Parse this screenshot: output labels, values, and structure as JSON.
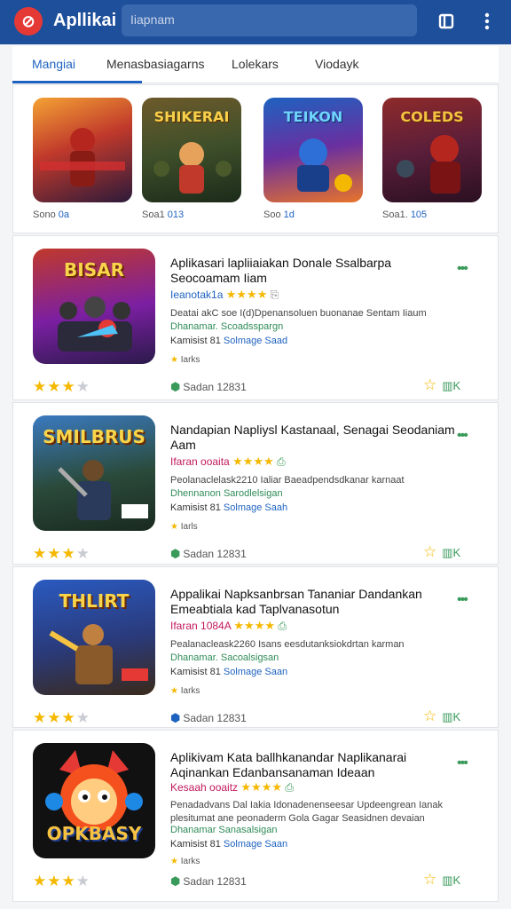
{
  "appbar": {
    "logo_glyph": "⊘",
    "title": "Apllikai",
    "search_placeholder": "Iiapnam",
    "icons": [
      "bookmark-icon",
      "more-vert-icon"
    ]
  },
  "tabs": [
    "Mangiai",
    "Menasbasiagarns",
    "Lolekars",
    "Viodayk"
  ],
  "featured": [
    {
      "name": "",
      "label": "Sono",
      "value": "0a"
    },
    {
      "name": "SHIKERAI",
      "label": "Soa1",
      "value": "013"
    },
    {
      "name": "TEIKON",
      "label": "Soo",
      "value": "1d"
    },
    {
      "name": "COLEDS",
      "label": "Soa1.",
      "value": "105"
    }
  ],
  "apps": [
    {
      "img_title": "BISAR",
      "title": "Aplikasari lapliiaiakan Donale Ssalbarpa Seocoamam Iiam",
      "rating_label": "Ieanotak1a",
      "rating_label_color": "blue",
      "desc": "Deatai akC soe I(d)Dpenansoluen buonanae Sentam Iiaum",
      "dev": "Dhanamar. Scoadsspargn",
      "size_prefix": "Kamisist 81",
      "size_value": "Solmage Saad",
      "tag": "Iarks",
      "date": "Sadan 12831",
      "pin_color": "green"
    },
    {
      "img_title": "SMILBRUS",
      "title": "Nandapian Napliysl Kastanaal, Senagai Seodaniam Aam",
      "rating_label": "Ifaran ooaita",
      "rating_label_color": "pink",
      "desc": "Peolanaclelask2210 Ialiar Baeadpendsdkanar karnaat",
      "dev": "Dhennanon Sarodlelsigan",
      "size_prefix": "Kamisist 81",
      "size_value": "Solmage Saah",
      "tag": "Iarls",
      "date": "Sadan 12831",
      "pin_color": "green"
    },
    {
      "img_title": "THLIRT",
      "title": "Appalikai Napksanbrsan Tananiar Dandankan Emeabtiala kad Taplvanasotun",
      "rating_label": "Ifaran 1084A",
      "rating_label_color": "pink",
      "desc": "Pealanacleask2260 Isans eesdutanksiokdrtan karman",
      "dev": "Dhanamar. Sacoalsigsan",
      "size_prefix": "Kamisist 81",
      "size_value": "Solmage Saan",
      "tag": "Iarks",
      "date": "Sadan 12831",
      "pin_color": "blue"
    },
    {
      "img_title": "OPKBASY",
      "title": "Aplikivam Kata ballhkanandar Naplikanarai Aqinankan Edanbansanaman Ideaan",
      "rating_label": "Kesaah ooaitz",
      "rating_label_color": "pink",
      "desc": "Penadadvans Dal Iakia Idonadenenseesar Updeengrean Ianak plesitumat ane peonaderm Gola Gagar Seasidnen devaian",
      "dev": "Dhanamar Sanasalsigan",
      "size_prefix": "Kamisist 81",
      "size_value": "Solmage Saan",
      "tag": "Iarks",
      "date": "Sadan 12831",
      "pin_color": "green"
    }
  ],
  "colors": {
    "appbar": "#1e4f9a",
    "accent": "#1e62c0",
    "star": "#f5b800",
    "green": "#3a9a5a",
    "pink": "#c2185b"
  }
}
